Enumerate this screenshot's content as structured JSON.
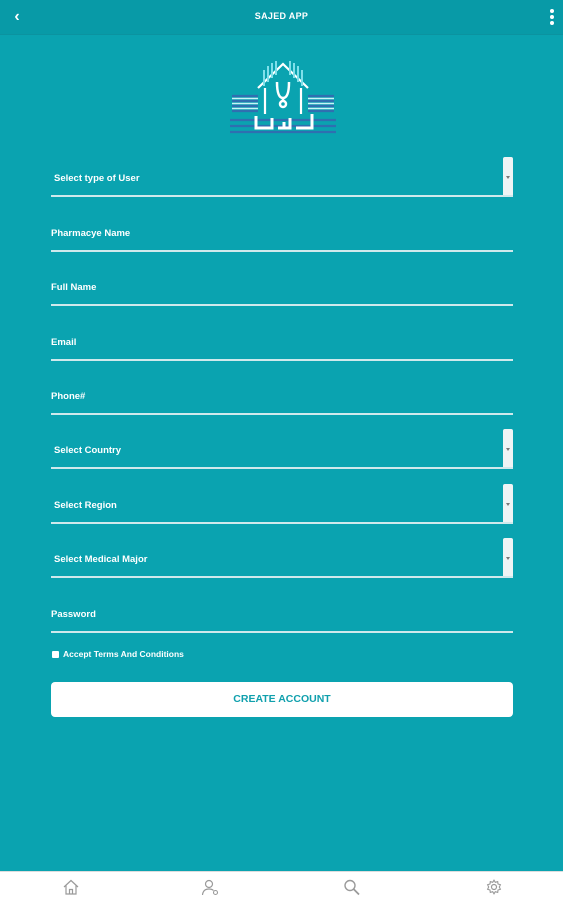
{
  "app": {
    "title": "SAJED APP"
  },
  "icons": {
    "back": "back-arrow-icon",
    "more": "more-vert-icon",
    "home": "home-icon",
    "user": "user-settings-icon",
    "search": "search-icon",
    "settings": "gear-icon"
  },
  "colors": {
    "background": "#0aa3b0",
    "topbar": "#089aa7",
    "button_text": "#10a0ad"
  },
  "form": {
    "user_type": {
      "placeholder": "Select type of User"
    },
    "pharmacy_name": {
      "placeholder": "Pharmacye Name"
    },
    "full_name": {
      "placeholder": "Full Name"
    },
    "email": {
      "placeholder": "Email"
    },
    "phone": {
      "placeholder": "Phone#"
    },
    "country": {
      "placeholder": "Select Country"
    },
    "region": {
      "placeholder": "Select Region"
    },
    "medical_major": {
      "placeholder": "Select Medical Major"
    },
    "password": {
      "placeholder": "Password"
    },
    "terms_label": "Accept Terms And Conditions",
    "create_label": "CREATE ACCOUNT"
  }
}
